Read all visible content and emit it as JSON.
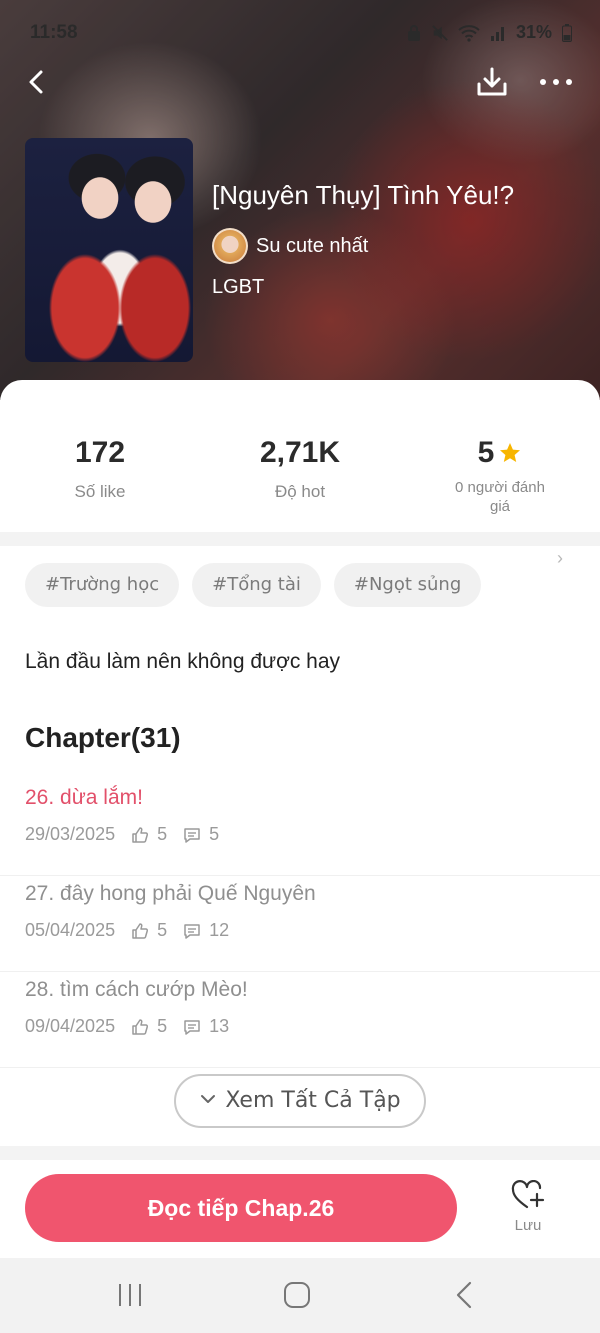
{
  "status_bar": {
    "time": "11:58",
    "battery": "31%"
  },
  "header": {},
  "novel": {
    "title": "[Nguyên Thụy] Tình Yêu!?",
    "author": "Su cute nhất",
    "genre": "LGBT"
  },
  "stats": {
    "likes": {
      "value": "172",
      "label": "Số like"
    },
    "hot": {
      "value": "2,71K",
      "label": "Độ hot"
    },
    "rating": {
      "value": "5",
      "label": "0 người đánh giá"
    }
  },
  "tags": [
    "#Trường học",
    "#Tổng tài",
    "#Ngọt sủng"
  ],
  "description": "Lần đầu làm nên không được hay",
  "chapter_heading": "Chapter(31)",
  "chapters": [
    {
      "title": "26. dừa lắm!",
      "date": "29/03/2025",
      "likes": "5",
      "comments": "5"
    },
    {
      "title": "27. đây hong phải Quế Nguyên",
      "date": "05/04/2025",
      "likes": "5",
      "comments": "12"
    },
    {
      "title": "28. tìm cách cướp Mèo!",
      "date": "09/04/2025",
      "likes": "5",
      "comments": "13"
    }
  ],
  "see_all_label": "Xem Tất Cả Tập",
  "continue_label": "Đọc tiếp Chap.26",
  "save_label": "Lưu",
  "colors": {
    "accent": "#f0556e",
    "current_chapter": "#e2506a",
    "star": "#f7b500"
  }
}
